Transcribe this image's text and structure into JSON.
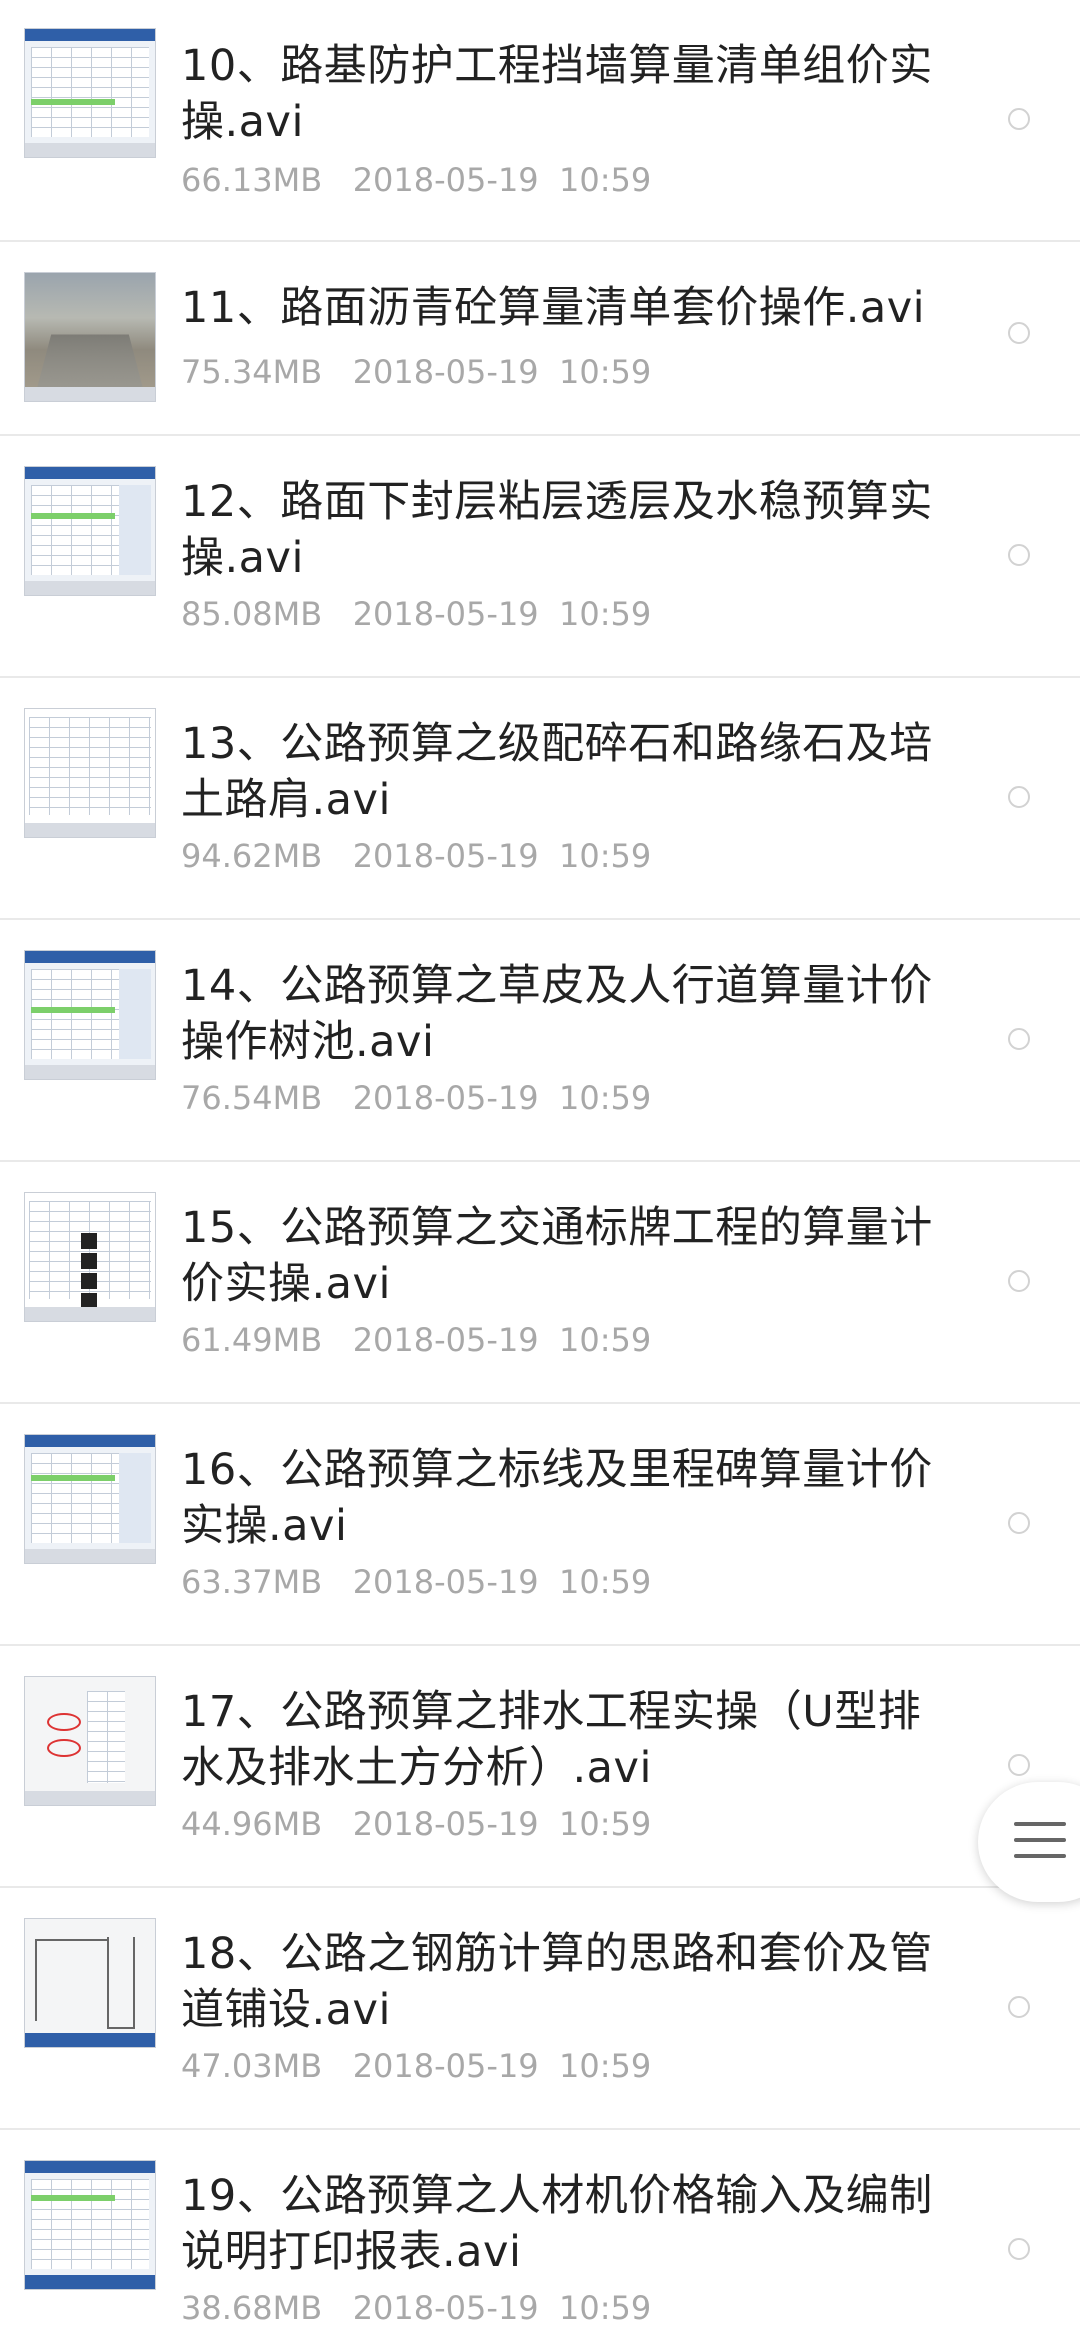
{
  "files": [
    {
      "title": "10、路基防护工程挡墙算量清单组价实操.avi",
      "size": "66.13MB",
      "date": "2018-05-19",
      "time": "10:59",
      "thumbnail": "software-screenshot"
    },
    {
      "title": "11、路面沥青砼算量清单套价操作.avi",
      "size": "75.34MB",
      "date": "2018-05-19",
      "time": "10:59",
      "thumbnail": "road-photo"
    },
    {
      "title": "12、路面下封层粘层透层及水稳预算实操.avi",
      "size": "85.08MB",
      "date": "2018-05-19",
      "time": "10:59",
      "thumbnail": "software-screenshot"
    },
    {
      "title": "13、公路预算之级配碎石和路缘石及培土路肩.avi",
      "size": "94.62MB",
      "date": "2018-05-19",
      "time": "10:59",
      "thumbnail": "table-screenshot"
    },
    {
      "title": "14、公路预算之草皮及人行道算量计价操作树池.avi",
      "size": "76.54MB",
      "date": "2018-05-19",
      "time": "10:59",
      "thumbnail": "software-screenshot"
    },
    {
      "title": "15、公路预算之交通标牌工程的算量计价实操.avi",
      "size": "61.49MB",
      "date": "2018-05-19",
      "time": "10:59",
      "thumbnail": "table-black-cells"
    },
    {
      "title": "16、公路预算之标线及里程碑算量计价实操.avi",
      "size": "63.37MB",
      "date": "2018-05-19",
      "time": "10:59",
      "thumbnail": "software-screenshot"
    },
    {
      "title": "17、公路预算之排水工程实操（U型排水及排水土方分析）.avi",
      "size": "44.96MB",
      "date": "2018-05-19",
      "time": "10:59",
      "thumbnail": "drawing-red-ovals"
    },
    {
      "title": "18、公路之钢筋计算的思路和套价及管道铺设.avi",
      "size": "47.03MB",
      "date": "2018-05-19",
      "time": "10:59",
      "thumbnail": "cad-drawing"
    },
    {
      "title": "19、公路预算之人材机价格输入及编制说明打印报表.avi",
      "size": "38.68MB",
      "date": "2018-05-19",
      "time": "10:59",
      "thumbnail": "software-screenshot"
    }
  ],
  "floating_menu": {
    "icon": "menu-icon"
  },
  "colors": {
    "title": "#222222",
    "meta": "#a8a8a8",
    "divider": "#e9e9e9",
    "radio_border": "#d2d2d2"
  }
}
